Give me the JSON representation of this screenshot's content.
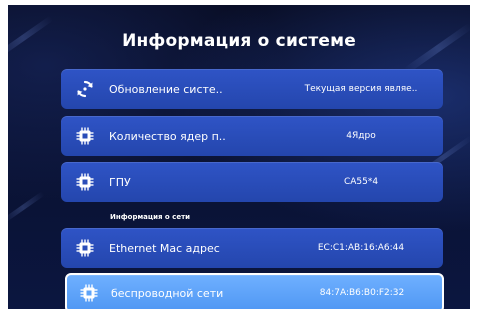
{
  "header": {
    "title": "Информация о системе"
  },
  "items": [
    {
      "label": "Обновление систе..",
      "value": "Текущая версия являе..",
      "icon": "refresh-icon"
    },
    {
      "label": "Количество ядер п..",
      "value": "4Ядро",
      "icon": "chip-icon"
    },
    {
      "label": "ГПУ",
      "value": "CA55*4",
      "icon": "chip-icon"
    }
  ],
  "network_section": {
    "title": "Информация о сети",
    "items": [
      {
        "label": "Ethernet Mac адрес",
        "value": "EC:C1:AB:16:A6:44",
        "icon": "chip-icon"
      },
      {
        "label": "беспроводной сети",
        "value": "84:7A:B6:B0:F2:32",
        "icon": "chip-icon",
        "selected": true
      }
    ]
  },
  "colors": {
    "row": "#2a4db8",
    "row_selected": "#5ea3f8",
    "background": "#0a1233"
  }
}
